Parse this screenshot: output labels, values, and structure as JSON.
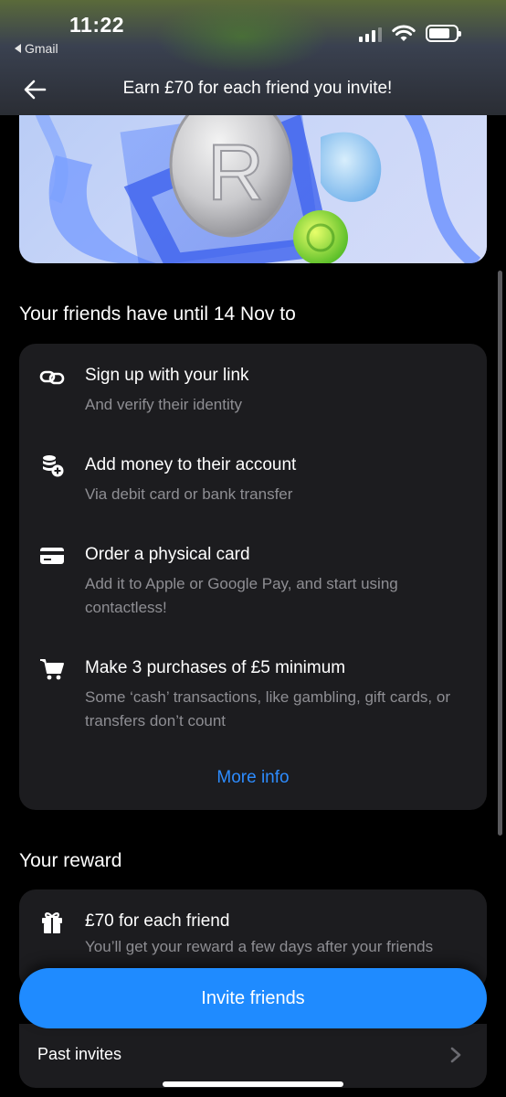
{
  "status_bar": {
    "time": "11:22",
    "back_app": "Gmail"
  },
  "header": {
    "title": "Earn £70 for each friend you invite!"
  },
  "steps_section": {
    "title": "Your friends have until 14 Nov to",
    "steps": [
      {
        "icon": "link-icon",
        "title": "Sign up with your link",
        "subtitle": "And verify their identity"
      },
      {
        "icon": "add-money-icon",
        "title": "Add money to their account",
        "subtitle": "Via debit card or bank transfer"
      },
      {
        "icon": "card-icon",
        "title": "Order a physical card",
        "subtitle": "Add it to Apple or Google Pay, and start using contactless!"
      },
      {
        "icon": "cart-icon",
        "title": "Make 3 purchases of £5 minimum",
        "subtitle": "Some ‘cash’ transactions, like gambling, gift cards, or transfers don’t count"
      }
    ],
    "more_info": "More info"
  },
  "reward_section": {
    "title": "Your reward",
    "item_title": "£70 for each friend",
    "item_subtitle": "You’ll get your reward a few days after your friends"
  },
  "actions": {
    "invite_label": "Invite friends",
    "past_invites_label": "Past invites"
  },
  "colors": {
    "accent": "#1f8bff",
    "link": "#2d8cff",
    "card_bg": "#1c1c1f",
    "muted_text": "#8e8e93"
  }
}
